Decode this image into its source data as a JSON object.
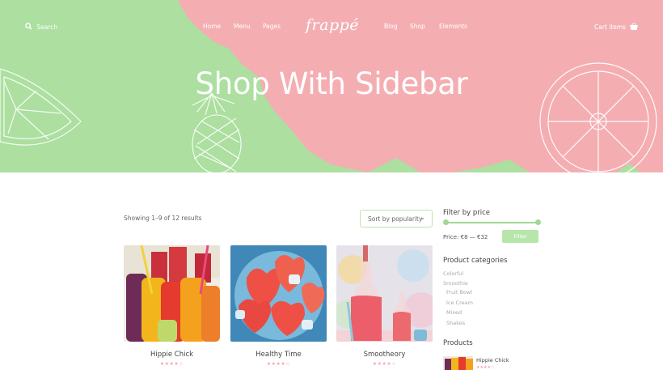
{
  "header": {
    "search_label": "Search",
    "nav_left": [
      "Home",
      "Menu",
      "Pages"
    ],
    "logo_text": "frappé",
    "nav_right": [
      "Blog",
      "Shop",
      "Elements"
    ],
    "cart_label": "Cart items"
  },
  "hero": {
    "title": "Shop With Sidebar",
    "colors": {
      "green": "#acdfa0",
      "pink": "#f4aeb2"
    }
  },
  "shop": {
    "results_count": "Showing 1–9 of 12 results",
    "sort_value": "Sort by popularity",
    "products": [
      {
        "name": "Hippie Chick",
        "stars": "★★★★☆"
      },
      {
        "name": "Healthy Time",
        "stars": "★★★★☆"
      },
      {
        "name": "Smootheory",
        "stars": "★★★★☆"
      }
    ]
  },
  "sidebar": {
    "filter_title": "Filter by price",
    "price_text": "Price: €8 — €32",
    "filter_button": "Filter",
    "categories_title": "Product categories",
    "categories": [
      "Colorful",
      "Smoothie",
      "Fruit Bowl",
      "Ice Cream",
      "Mixed",
      "Shakes"
    ],
    "products_title": "Products",
    "mini_product": {
      "name": "Hippie Chick",
      "stars": "★★★★☆"
    }
  }
}
